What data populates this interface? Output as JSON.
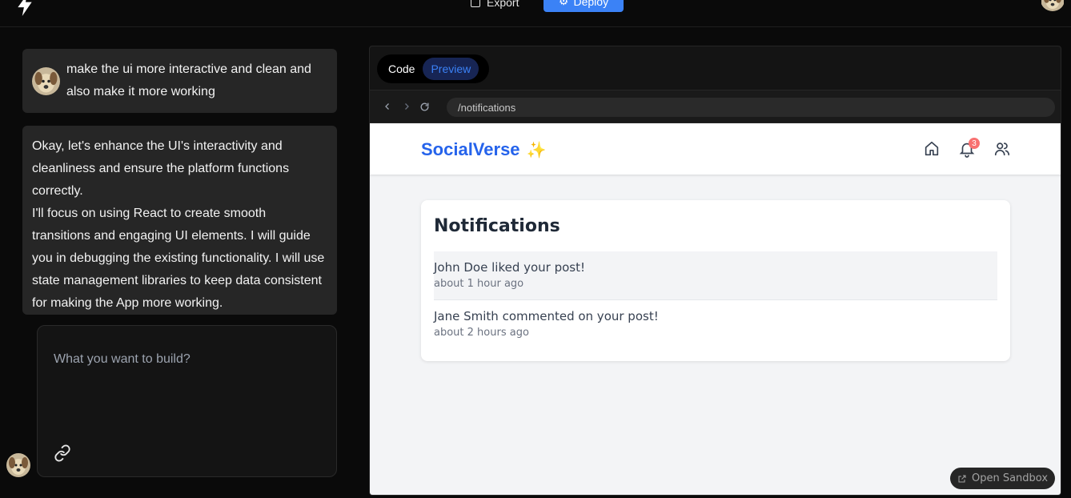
{
  "header": {
    "export_label": "Export",
    "deploy_label": "Deploy"
  },
  "chat": {
    "user_message": "make the ui more interactive and clean and also make it more working",
    "ai_message_p1": "Okay, let's enhance the UI's interactivity and cleanliness and ensure the platform functions correctly.",
    "ai_message_p2": "I'll focus on using React to create smooth transitions and engaging UI elements. I will guide you in debugging the existing functionality. I will use state management libraries to keep data consistent for making the App more working."
  },
  "prompt": {
    "placeholder": "What you want to build?"
  },
  "workbench": {
    "tabs": [
      {
        "label": "Code",
        "active": false
      },
      {
        "label": "Preview",
        "active": true
      }
    ],
    "url": "/notifications",
    "open_sandbox_label": "Open Sandbox"
  },
  "app": {
    "brand": "SocialVerse",
    "brand_emoji": "✨",
    "notification_count": "3",
    "page_title": "Notifications",
    "notifications": [
      {
        "text": "John Doe liked your post!",
        "time": "about 1 hour ago"
      },
      {
        "text": "Jane Smith commented on your post!",
        "time": "about 2 hours ago"
      }
    ]
  },
  "colors": {
    "accent": "#3b82f6",
    "brand": "#2563eb",
    "badge": "#f87171"
  }
}
